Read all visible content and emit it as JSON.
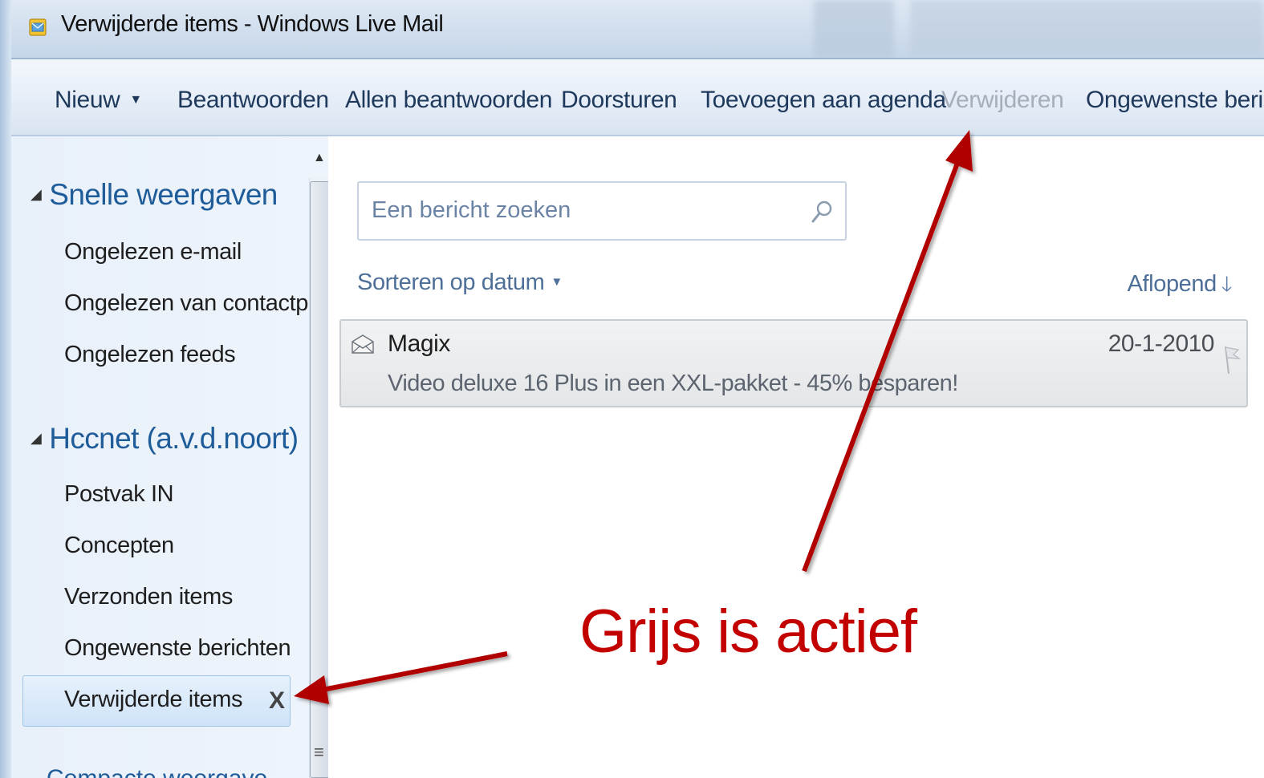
{
  "window": {
    "title": "Verwijderde items - Windows Live Mail"
  },
  "commandbar": {
    "items": [
      {
        "label": "Nieuw",
        "enabled": true,
        "has_dropdown": true
      },
      {
        "label": "Beantwoorden",
        "enabled": true
      },
      {
        "label": "Allen beantwoorden",
        "enabled": true
      },
      {
        "label": "Doorsturen",
        "enabled": true
      },
      {
        "label": "Toevoegen aan agenda",
        "enabled": true
      },
      {
        "label": "Verwijderen",
        "enabled": false
      },
      {
        "label": "Ongewenste bericht",
        "enabled": true
      }
    ]
  },
  "sidebar": {
    "sections": [
      {
        "title": "Snelle weergaven",
        "items": [
          "Ongelezen e-mail",
          "Ongelezen van contactp...",
          "Ongelezen feeds"
        ]
      },
      {
        "title": "Hccnet (a.v.d.noort)",
        "items": [
          "Postvak IN",
          "Concepten",
          "Verzonden items",
          "Ongewenste berichten",
          "Verwijderde items"
        ],
        "selected": "Verwijderde items",
        "selected_action": "X"
      }
    ],
    "next_section_partial": "Compacte weergave"
  },
  "search": {
    "placeholder": "Een bericht zoeken",
    "icon": "search-icon"
  },
  "list": {
    "sort_label": "Sorteren op datum",
    "order_label": "Aflopend",
    "messages": [
      {
        "sender": "Magix",
        "subject": "Video deluxe 16 Plus in een XXL-pakket - 45% besparen!",
        "date": "20-1-2010",
        "icon": "envelope-icon"
      }
    ]
  },
  "annotation": {
    "text": "Grijs is actief",
    "color": "#c30000"
  },
  "colors": {
    "accent": "#1f5c9a",
    "disabled": "#a6aebb",
    "annotation": "#c30000"
  }
}
